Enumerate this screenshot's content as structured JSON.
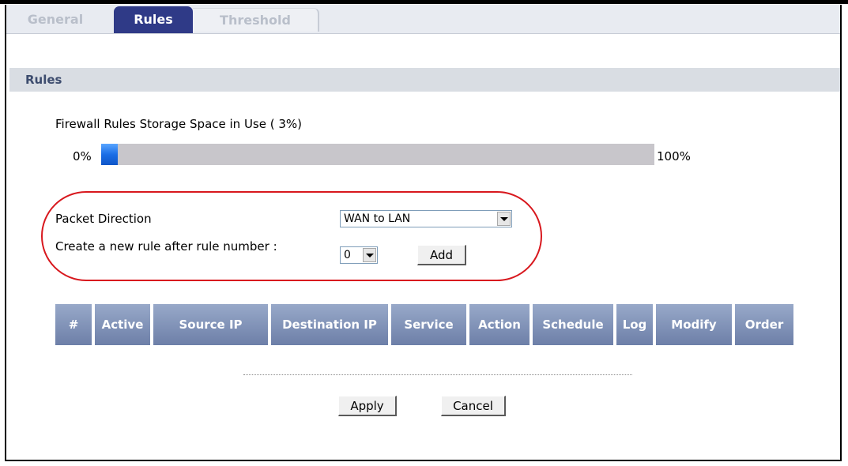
{
  "tabs": [
    {
      "label": "General",
      "active": false
    },
    {
      "label": "Rules",
      "active": true
    },
    {
      "label": "Threshold",
      "active": false
    }
  ],
  "section": {
    "title": "Rules"
  },
  "storage": {
    "label": "Firewall Rules Storage Space in Use",
    "value_text": "( 3%)",
    "percent": 3,
    "min_label": "0%",
    "max_label": "100%"
  },
  "form": {
    "packet_direction_label": "Packet Direction",
    "packet_direction_value": "WAN to LAN",
    "new_rule_label": "Create a new rule after rule number :",
    "new_rule_value": "0",
    "add_label": "Add"
  },
  "table": {
    "headers": [
      "#",
      "Active",
      "Source IP",
      "Destination IP",
      "Service",
      "Action",
      "Schedule",
      "Log",
      "Modify",
      "Order"
    ]
  },
  "buttons": {
    "apply": "Apply",
    "cancel": "Cancel"
  },
  "colors": {
    "active_tab": "#2f3a87",
    "table_header": "#7b8db4",
    "progress_fill": "#1b6ee6",
    "highlight_oval": "#d8181e"
  }
}
